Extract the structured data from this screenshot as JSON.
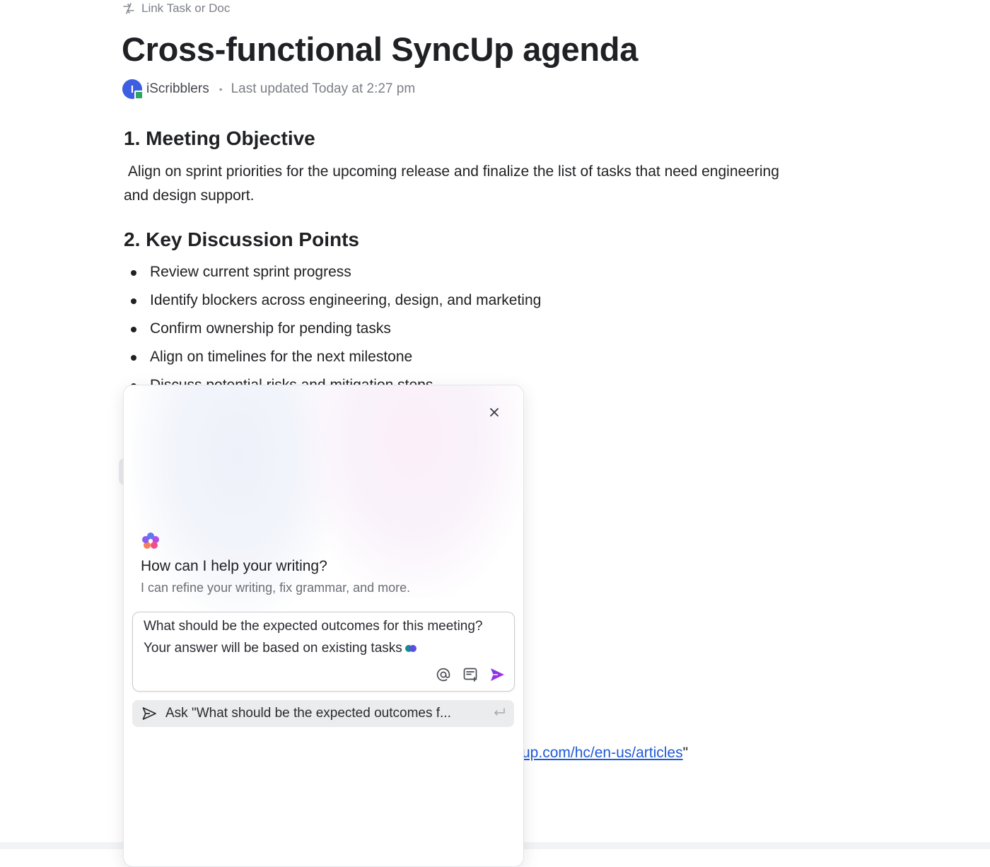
{
  "link_task": {
    "label": "Link Task or Doc",
    "icon": "link-arrows-icon"
  },
  "doc": {
    "title": "Cross-functional SyncUp agenda",
    "author_initial": "I",
    "author": "iScribblers",
    "separator": "•",
    "last_updated": "Last updated Today at 2:27 pm"
  },
  "sections": {
    "objective": {
      "heading": "1. Meeting Objective",
      "text": " Align on sprint priorities for the upcoming release and finalize the list of tasks that need engineering and design support."
    },
    "discussion": {
      "heading": "2. Key Discussion Points",
      "items": [
        "Review current sprint progress",
        "Identify blockers across engineering, design, and marketing",
        "Confirm ownership for pending tasks",
        "Align on timelines for the next milestone",
        "Discuss potential risks and mitigation steps"
      ]
    }
  },
  "partial_link": {
    "url_text": "up.com/hc/en-us/articles",
    "suffix": "\""
  },
  "ai_panel": {
    "heading": "How can I help your writing?",
    "subheading": "I can refine your writing, fix grammar, and more.",
    "prompt_value": "What should be the expected outcomes for this meeting? Your answer will be based on existing tasks",
    "ask_suggestion": "Ask \"What should be the expected outcomes f...",
    "tools": [
      "mention-icon",
      "doc-context-icon",
      "send-icon"
    ]
  },
  "colors": {
    "accent_purple": "#8a2be2",
    "avatar_blue": "#3d5ee1",
    "presence_green": "#2ca565",
    "link_blue": "#1f5bd6",
    "dot_teal": "#1a8a8a",
    "dot_indigo": "#5a4fe0"
  }
}
